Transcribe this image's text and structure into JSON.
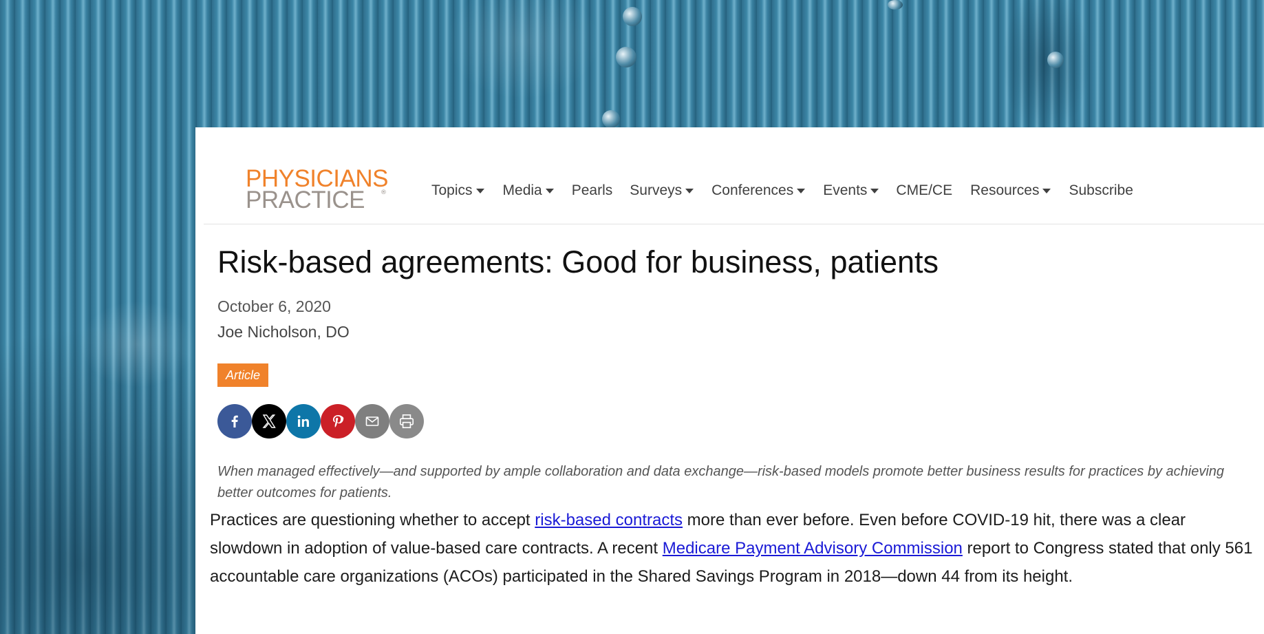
{
  "site": {
    "logo_line1": "PHYSICIANS",
    "logo_line2": "PRACTICE",
    "logo_mark": "®"
  },
  "nav": {
    "items": [
      {
        "label": "Topics",
        "dropdown": true
      },
      {
        "label": "Media",
        "dropdown": true
      },
      {
        "label": "Pearls",
        "dropdown": false
      },
      {
        "label": "Surveys",
        "dropdown": true
      },
      {
        "label": "Conferences",
        "dropdown": true
      },
      {
        "label": "Events",
        "dropdown": true
      },
      {
        "label": "CME/CE",
        "dropdown": false
      },
      {
        "label": "Resources",
        "dropdown": true
      },
      {
        "label": "Subscribe",
        "dropdown": false
      }
    ]
  },
  "article": {
    "title": "Risk-based agreements: Good for business, patients",
    "date": "October 6, 2020",
    "author": "Joe Nicholson, DO",
    "badge": "Article",
    "summary": "When managed effectively—and supported by ample collaboration and data exchange—risk-based models promote better business results for practices by achieving better outcomes for patients.",
    "body": {
      "p1_text1": "Practices are questioning whether to accept ",
      "p1_link1": "risk-based contracts",
      "p1_text2": " more than ever before. Even before COVID-19 hit, there was a clear slowdown in adoption of value-based care contracts. A recent ",
      "p1_link2": "Medicare Payment Advisory Commission",
      "p1_text3": " report to Congress stated that only 561 accountable care organizations (ACOs) participated in the Shared Savings Program in 2018—down 44 from its height."
    }
  },
  "share": [
    {
      "name": "facebook-icon",
      "color": "#3b5998"
    },
    {
      "name": "x-icon",
      "color": "#000000"
    },
    {
      "name": "linkedin-icon",
      "color": "#0e76a8"
    },
    {
      "name": "pinterest-icon",
      "color": "#cb2027"
    },
    {
      "name": "email-icon",
      "color": "#7f7f7f"
    },
    {
      "name": "print-icon",
      "color": "#8a8a8a"
    }
  ],
  "colors": {
    "brand_orange": "#f0822b",
    "brand_gray": "#9a928c",
    "link": "#1a1ad6",
    "background_blue": "#3a82a2"
  }
}
